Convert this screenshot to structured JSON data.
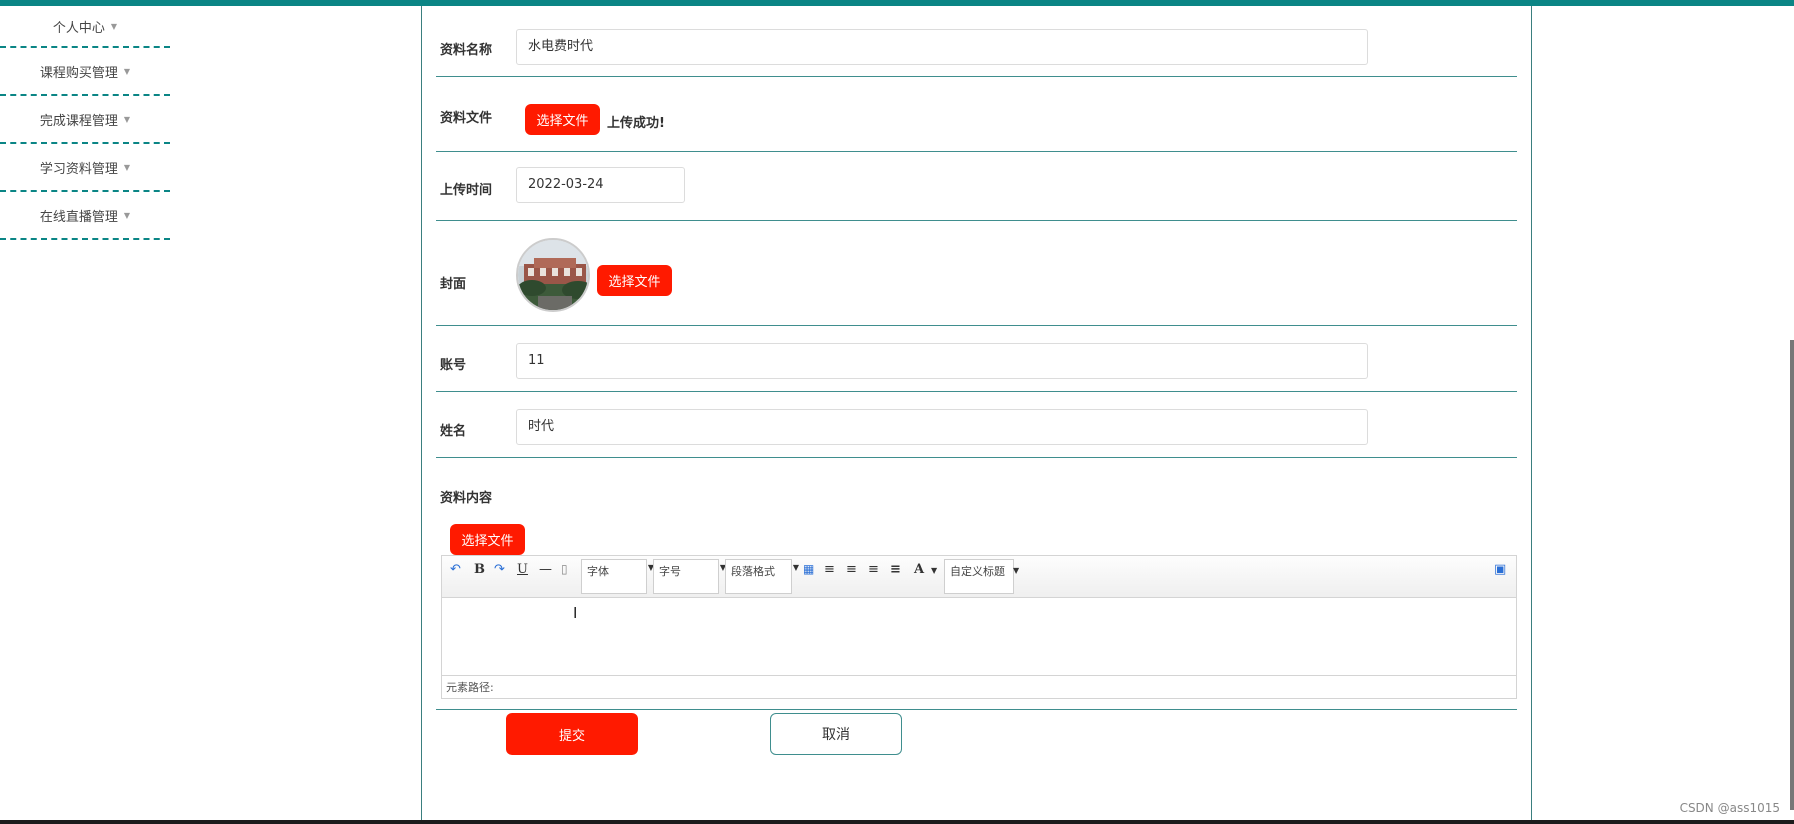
{
  "sidebar": {
    "items": [
      {
        "label": "个人中心"
      },
      {
        "label": "课程购买管理"
      },
      {
        "label": "完成课程管理"
      },
      {
        "label": "学习资料管理"
      },
      {
        "label": "在线直播管理"
      }
    ]
  },
  "form": {
    "name": {
      "label": "资料名称",
      "value": "水电费时代"
    },
    "file": {
      "label": "资料文件",
      "button": "选择文件",
      "status": "上传成功!"
    },
    "upload_time": {
      "label": "上传时间",
      "value": "2022-03-24"
    },
    "cover": {
      "label": "封面",
      "button": "选择文件"
    },
    "account": {
      "label": "账号",
      "value": "11"
    },
    "fullname": {
      "label": "姓名",
      "value": "时代"
    },
    "content": {
      "label": "资料内容",
      "button": "选择文件"
    }
  },
  "editor": {
    "font_family": "字体",
    "font_size": "字号",
    "paragraph": "段落格式",
    "custom_title": "自定义标题",
    "bold": "B",
    "underline": "U",
    "font_color": "A",
    "element_path": "元素路径:"
  },
  "actions": {
    "submit": "提交",
    "cancel": "取消"
  },
  "watermark": "CSDN @ass1015",
  "colors": {
    "accent": "#0b8585",
    "primary_button": "#ff1a00"
  }
}
